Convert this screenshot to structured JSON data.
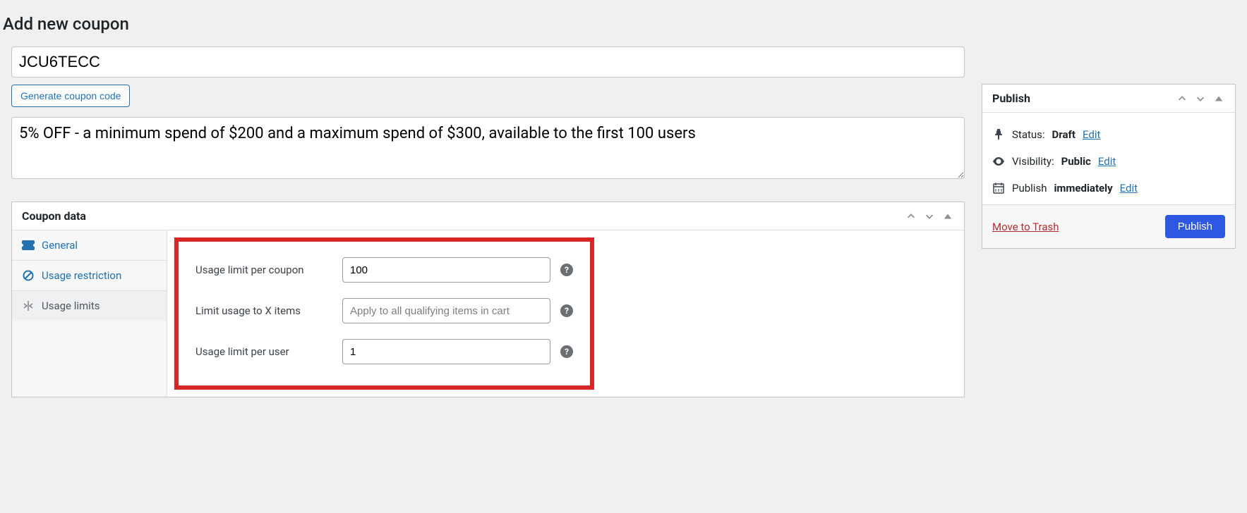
{
  "page": {
    "title": "Add new coupon"
  },
  "coupon": {
    "code": "JCU6TECC",
    "generate_label": "Generate coupon code",
    "description": "5% OFF - a minimum spend of $200 and a maximum spend of $300, available to the first 100 users"
  },
  "coupon_data": {
    "title": "Coupon data",
    "tabs": {
      "general": "General",
      "usage_restriction": "Usage restriction",
      "usage_limits": "Usage limits"
    },
    "fields": {
      "per_coupon": {
        "label": "Usage limit per coupon",
        "value": "100"
      },
      "x_items": {
        "label": "Limit usage to X items",
        "value": "",
        "placeholder": "Apply to all qualifying items in cart"
      },
      "per_user": {
        "label": "Usage limit per user",
        "value": "1"
      }
    }
  },
  "publish": {
    "title": "Publish",
    "status_label": "Status:",
    "status_value": "Draft",
    "visibility_label": "Visibility:",
    "visibility_value": "Public",
    "schedule_label": "Publish",
    "schedule_value": "immediately",
    "edit_label": "Edit",
    "trash_label": "Move to Trash",
    "publish_btn": "Publish"
  },
  "icons": {
    "help": "?"
  }
}
